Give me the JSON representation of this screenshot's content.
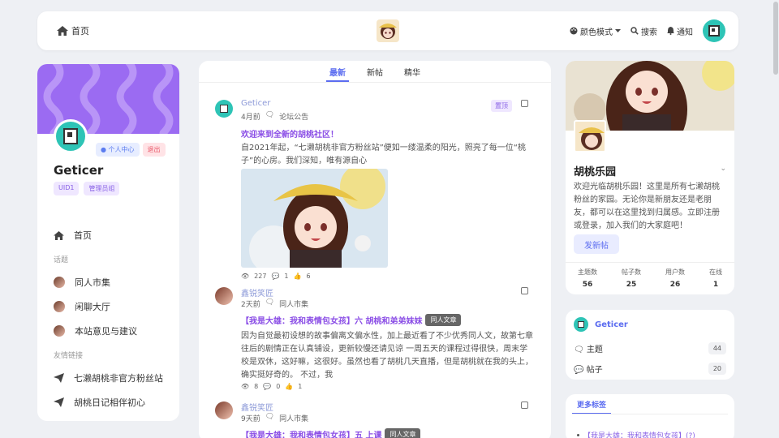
{
  "topbar": {
    "home_label": "首页",
    "color_mode_label": "颜色模式",
    "search_label": "搜索",
    "notify_label": "通知"
  },
  "profile": {
    "center_btn": "个人中心",
    "logout_btn": "退出",
    "username": "Geticer",
    "uid": "UID1",
    "role": "管理员组"
  },
  "sidebar": {
    "home": "首页",
    "topics_header": "话题",
    "topics": [
      "同人市集",
      "闲聊大厅",
      "本站意见与建议"
    ],
    "links_header": "友情链接",
    "links": [
      "七濑胡桃非官方粉丝站",
      "胡桃日记相伴初心"
    ]
  },
  "feed": {
    "tabs": [
      "最新",
      "新帖",
      "精华"
    ],
    "posts": [
      {
        "author": "Geticer",
        "time": "4月前",
        "category": "论坛公告",
        "badge": "置顶",
        "title": "欢迎来到全新的胡桃社区！",
        "body": "自2021年起，“七濑胡桃非官方粉丝站”便如一缕温柔的阳光，照亮了每一位“桃子”的心房。我们深知，唯有源自心",
        "views": "227",
        "replies": "1",
        "likes": "6"
      },
      {
        "author": "鑫锐笑匠",
        "time": "2天前",
        "category": "同人市集",
        "title": "【我是大雄：我和表情包女孩】六 胡桃和弟弟妹妹",
        "tag": "同人文章",
        "body": "因为自觉最初设想的故事偏离文偏水性，加上最近看了不少优秀同人文，故第七章往后的剧情正在认真铺设，更新较慢还请见谅 一周五天的课程过得很快，周末学校是双休，这好嘛，这很好。虽然也看了胡桃几天直播，但是胡桃就在我的头上，确实挺好奇的。 不过，我",
        "views": "8",
        "replies": "0",
        "likes": "1"
      },
      {
        "author": "鑫锐笑匠",
        "time": "9天前",
        "category": "同人市集",
        "title": "【我是大雄：我和表情包女孩】五 上课",
        "tag": "同人文章"
      }
    ]
  },
  "group": {
    "name": "胡桃乐园",
    "desc": "欢迎光临胡桃乐园！这里是所有七濑胡桃粉丝的家园。无论你是新朋友还是老朋友，都可以在这里找到归属感。立即注册或登录，加入我们的大家庭吧！",
    "post_btn": "发新帖",
    "stats": [
      {
        "label": "主题数",
        "value": "56"
      },
      {
        "label": "帖子数",
        "value": "25"
      },
      {
        "label": "用户数",
        "value": "26"
      },
      {
        "label": "在线",
        "value": "1"
      }
    ]
  },
  "user_card": {
    "name": "Geticer",
    "topics_label": "主题",
    "topics_count": "44",
    "posts_label": "帖子",
    "posts_count": "20"
  },
  "more_tags": {
    "tab": "更多标签",
    "first_item": "【我是大雄：我和表情包女孩】(?)"
  },
  "colors": {
    "accent": "#5b6cf0",
    "purple_title": "#8a4de6",
    "banner": "#9b6bf2",
    "avatar_teal": "#2ec4b6"
  }
}
